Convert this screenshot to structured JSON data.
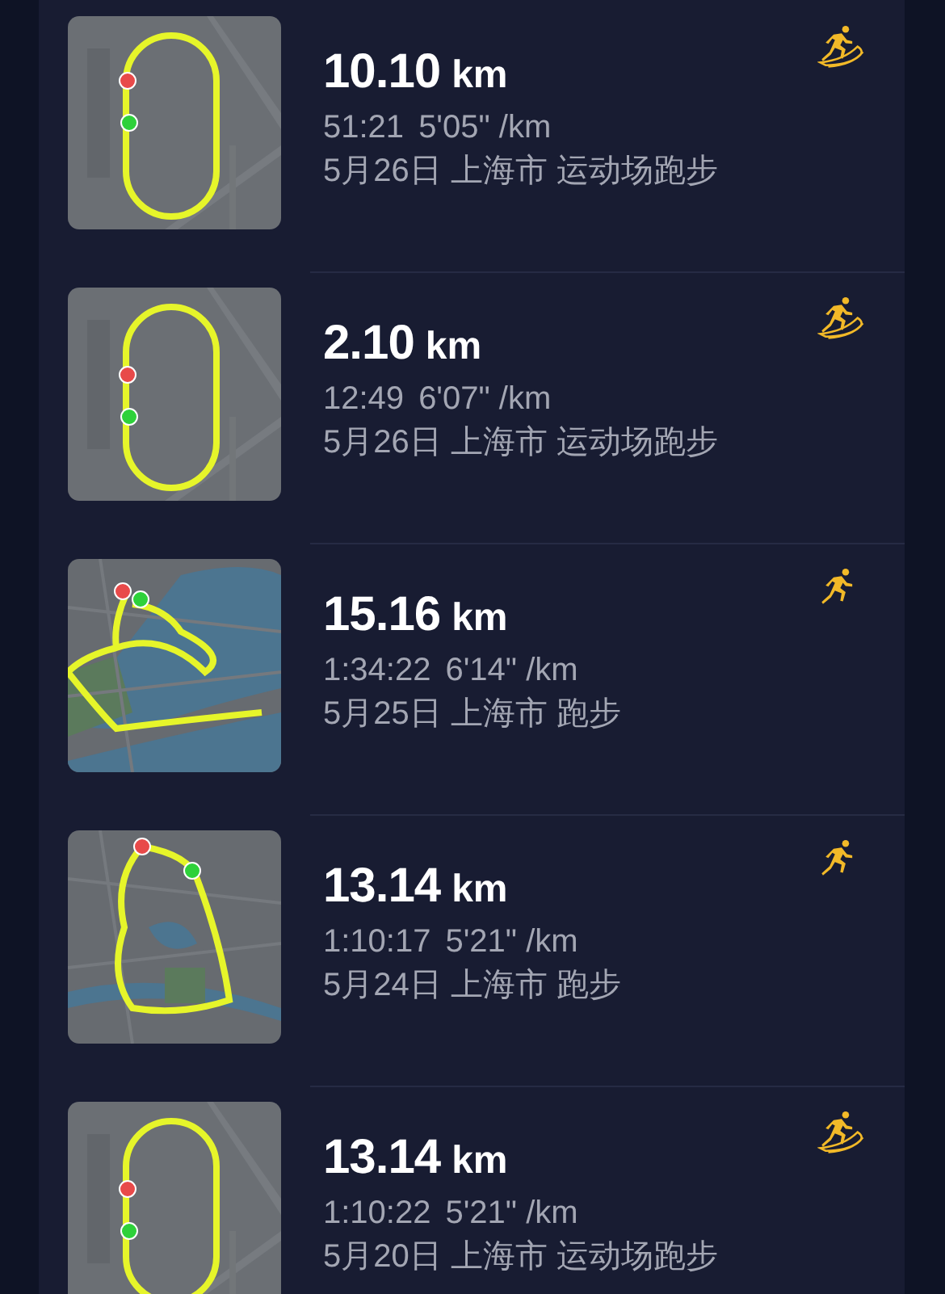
{
  "workouts": [
    {
      "kind": "track",
      "distance": "10.10",
      "unit": "km",
      "duration": "51:21",
      "pace": "5'05\" /km",
      "details": "5月26日 上海市 运动场跑步"
    },
    {
      "kind": "track",
      "distance": "2.10",
      "unit": "km",
      "duration": "12:49",
      "pace": "6'07\" /km",
      "details": "5月26日 上海市 运动场跑步"
    },
    {
      "kind": "run",
      "distance": "15.16",
      "unit": "km",
      "duration": "1:34:22",
      "pace": "6'14\" /km",
      "details": "5月25日 上海市 跑步"
    },
    {
      "kind": "run",
      "distance": "13.14",
      "unit": "km",
      "duration": "1:10:17",
      "pace": "5'21\" /km",
      "details": "5月24日 上海市 跑步"
    },
    {
      "kind": "track",
      "distance": "13.14",
      "unit": "km",
      "duration": "1:10:22",
      "pace": "5'21\" /km",
      "details": "5月20日 上海市 运动场跑步"
    }
  ]
}
